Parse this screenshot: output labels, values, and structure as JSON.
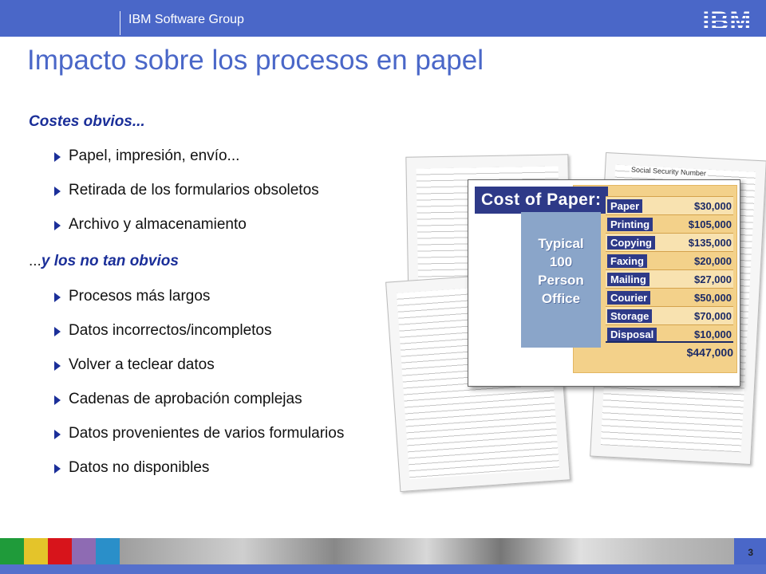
{
  "header": {
    "group": "IBM Software Group",
    "logo": "IBM"
  },
  "title": "Impacto sobre los procesos en papel",
  "section1": {
    "heading": "Costes obvios...",
    "items": [
      "Papel, impresión, envío...",
      "Retirada de los formularios obsoletos",
      "Archivo y almacenamiento"
    ]
  },
  "section2": {
    "prefix": "...",
    "heading": "y los no tan obvios",
    "items": [
      "Procesos más largos",
      "Datos incorrectos/incompletos",
      "Volver a teclear datos",
      "Cadenas de aprobación complejas",
      "Datos provenientes de varios formularios",
      "Datos no disponibles"
    ]
  },
  "cost_card": {
    "title": "Cost of Paper:",
    "subtitle": "Typical\n100\nPerson\nOffice",
    "rows": [
      {
        "label": "Paper",
        "value": "$30,000"
      },
      {
        "label": "Printing",
        "value": "$105,000"
      },
      {
        "label": "Copying",
        "value": "$135,000"
      },
      {
        "label": "Faxing",
        "value": "$20,000"
      },
      {
        "label": "Mailing",
        "value": "$27,000"
      },
      {
        "label": "Courier",
        "value": "$50,000"
      },
      {
        "label": "Storage",
        "value": "$70,000"
      },
      {
        "label": "Disposal",
        "value": "$10,000"
      }
    ],
    "total": "$447,000"
  },
  "doc_caption": "Social Security Number",
  "footer": {
    "page_number": "3",
    "colors": [
      "#1f9b3a",
      "#e4c42a",
      "#d7141b",
      "#8e6bb3",
      "#2a8fc9"
    ]
  }
}
